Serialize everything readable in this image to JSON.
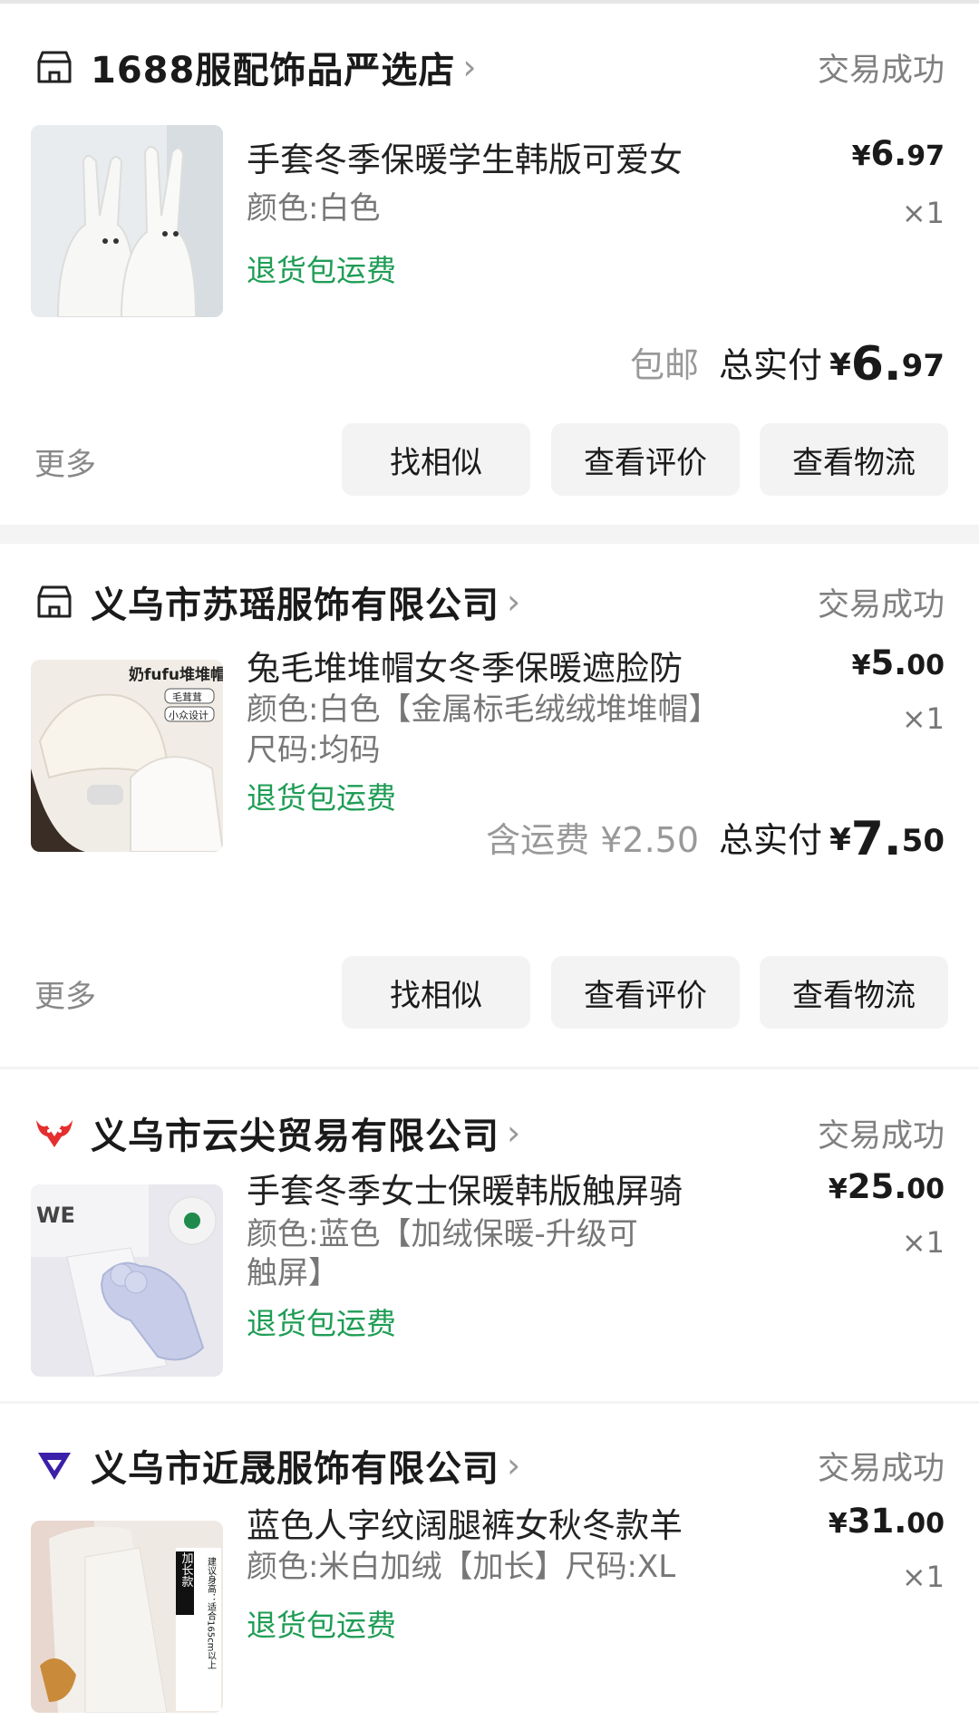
{
  "orders": [
    {
      "shop": "1688服配饰品严选店",
      "status": "交易成功",
      "item_title": "手套冬季保暖学生韩版可爱女",
      "specs": [
        "颜色:白色"
      ],
      "refund": "退货包运费",
      "price_yen": "¥",
      "price_int": "6.",
      "price_dec": "97",
      "qty": "×1",
      "shipping_note": "包邮",
      "total_label": "总实付",
      "total_yen": "¥",
      "total_int": "6.",
      "total_dec": "97",
      "more": "更多",
      "buttons": [
        "找相似",
        "查看评价",
        "查看物流"
      ]
    },
    {
      "shop": "义乌市苏瑶服饰有限公司",
      "status": "交易成功",
      "item_title": "兔毛堆堆帽女冬季保暖遮脸防",
      "specs": [
        "颜色:白色【金属标毛绒绒堆堆帽】",
        "尺码:均码"
      ],
      "refund": "退货包运费",
      "price_yen": "¥",
      "price_int": "5.",
      "price_dec": "00",
      "qty": "×1",
      "shipping_note": "含运费 ¥2.50",
      "total_label": "总实付",
      "total_yen": "¥",
      "total_int": "7.",
      "total_dec": "50",
      "more": "更多",
      "buttons": [
        "找相似",
        "查看评价",
        "查看物流"
      ]
    },
    {
      "shop": "义乌市云尖贸易有限公司",
      "status": "交易成功",
      "item_title": "手套冬季女士保暖韩版触屏骑",
      "specs": [
        "颜色:蓝色【加绒保暖-升级可",
        "触屏】"
      ],
      "refund": "退货包运费",
      "price_yen": "¥",
      "price_int": "25.",
      "price_dec": "00",
      "qty": "×1"
    },
    {
      "shop": "义乌市近晟服饰有限公司",
      "status": "交易成功",
      "item_title": "蓝色人字纹阔腿裤女秋冬款羊",
      "specs": [
        "颜色:米白加绒【加长】尺码:XL"
      ],
      "refund": "退货包运费",
      "price_yen": "¥",
      "price_int": "31.",
      "price_dec": "00",
      "qty": "×1"
    }
  ],
  "thumb_text": {
    "hat_brand": "奶fufu堆堆帽",
    "hat_tag1": "毛茸茸",
    "hat_tag2": "小众设计",
    "pants_tag": "加长款",
    "pants_note": "建议身高：适合165cm以上",
    "gloves_we": "WE"
  },
  "icons": {
    "order1": "store-icon",
    "order2": "store-icon",
    "order3": "red-bull-logo-icon",
    "order4": "purple-diamond-logo-icon"
  },
  "colors": {
    "refund": "#1f9d55",
    "status": "#808080"
  }
}
